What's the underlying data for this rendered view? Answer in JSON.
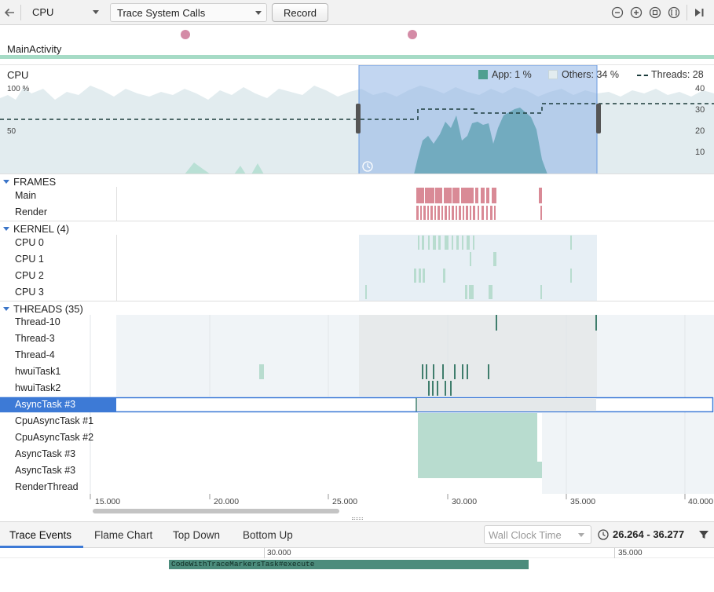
{
  "toolbar": {
    "profiler_select": "CPU",
    "config_select": "Trace System Calls",
    "record_label": "Record",
    "icons": [
      "back-arrow-icon",
      "zoom-out-icon",
      "zoom-in-icon",
      "reset-zoom-icon",
      "zoom-to-selection-icon",
      "go-to-live-icon"
    ]
  },
  "events": {
    "activity_label": "MainActivity",
    "dot_color": "#d48ba6"
  },
  "cpu": {
    "title": "CPU",
    "y_left_ticks": [
      "100 %",
      "50"
    ],
    "y_right_ticks": [
      "40",
      "30",
      "20",
      "10"
    ],
    "legend": {
      "app": "App: 1 %",
      "others": "Others: 34 %",
      "threads": "Threads: 28"
    },
    "colors": {
      "app": "#4e9f91",
      "others": "#e2ecef",
      "threads": "#1c3c3c",
      "selection": "#8fb4e6"
    }
  },
  "frames": {
    "header": "FRAMES",
    "rows": [
      "Main",
      "Render"
    ]
  },
  "kernel": {
    "header": "KERNEL (4)",
    "rows": [
      "CPU 0",
      "CPU 1",
      "CPU 2",
      "CPU 3"
    ]
  },
  "threads": {
    "header": "THREADS (35)",
    "rows": [
      "Thread-10",
      "Thread-3",
      "Thread-4",
      "hwuiTask1",
      "hwuiTask2",
      "AsyncTask #3",
      "CpuAsyncTask #1",
      "CpuAsyncTask #2",
      "AsyncTask #3",
      "AsyncTask #3",
      "RenderThread"
    ],
    "selected_index": 5
  },
  "timeline": {
    "ticks": [
      "15.000",
      "20.000",
      "25.000",
      "30.000",
      "35.000",
      "40.000"
    ]
  },
  "bottom": {
    "tabs": [
      "Trace Events",
      "Flame Chart",
      "Top Down",
      "Bottom Up"
    ],
    "active_tab": "Trace Events",
    "clock_select": "Wall Clock Time",
    "range": "26.264 - 36.277",
    "ticks": [
      "30.000",
      "35.000"
    ],
    "trace_event": "CodeWithTraceMarkersTask#execute"
  }
}
